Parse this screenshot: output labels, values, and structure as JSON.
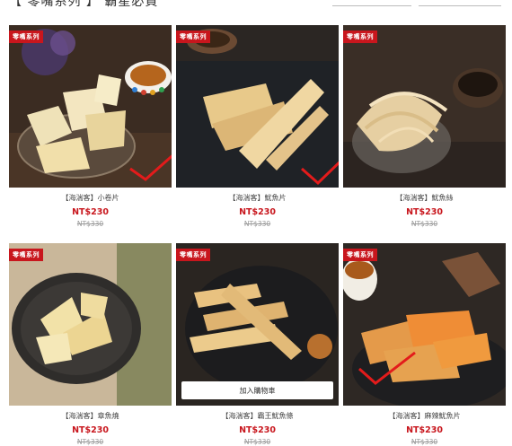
{
  "header": {
    "title": "【 零嘴系列 】 霸星必買"
  },
  "cart_label": "加入購物車",
  "products": [
    {
      "badge": "零嘴系列",
      "name": "【海湍客】小卷片",
      "price": "NT$230",
      "original_price": "NT$330"
    },
    {
      "badge": "零嘴系列",
      "name": "【海湍客】魷魚片",
      "price": "NT$230",
      "original_price": "NT$330"
    },
    {
      "badge": "零嘴系列",
      "name": "【海湍客】魷魚絲",
      "price": "NT$230",
      "original_price": "NT$330"
    },
    {
      "badge": "零嘴系列",
      "name": "【海湍客】章魚燒",
      "price": "NT$230",
      "original_price": "NT$330"
    },
    {
      "badge": "零嘴系列",
      "name": "【海湍客】霸王魷魚條",
      "price": "NT$230",
      "original_price": "NT$330"
    },
    {
      "badge": "零嘴系列",
      "name": "【海湍客】麻辣魷魚片",
      "price": "NT$230",
      "original_price": "NT$330"
    }
  ],
  "colors": {
    "accent_red": "#c8161d"
  }
}
